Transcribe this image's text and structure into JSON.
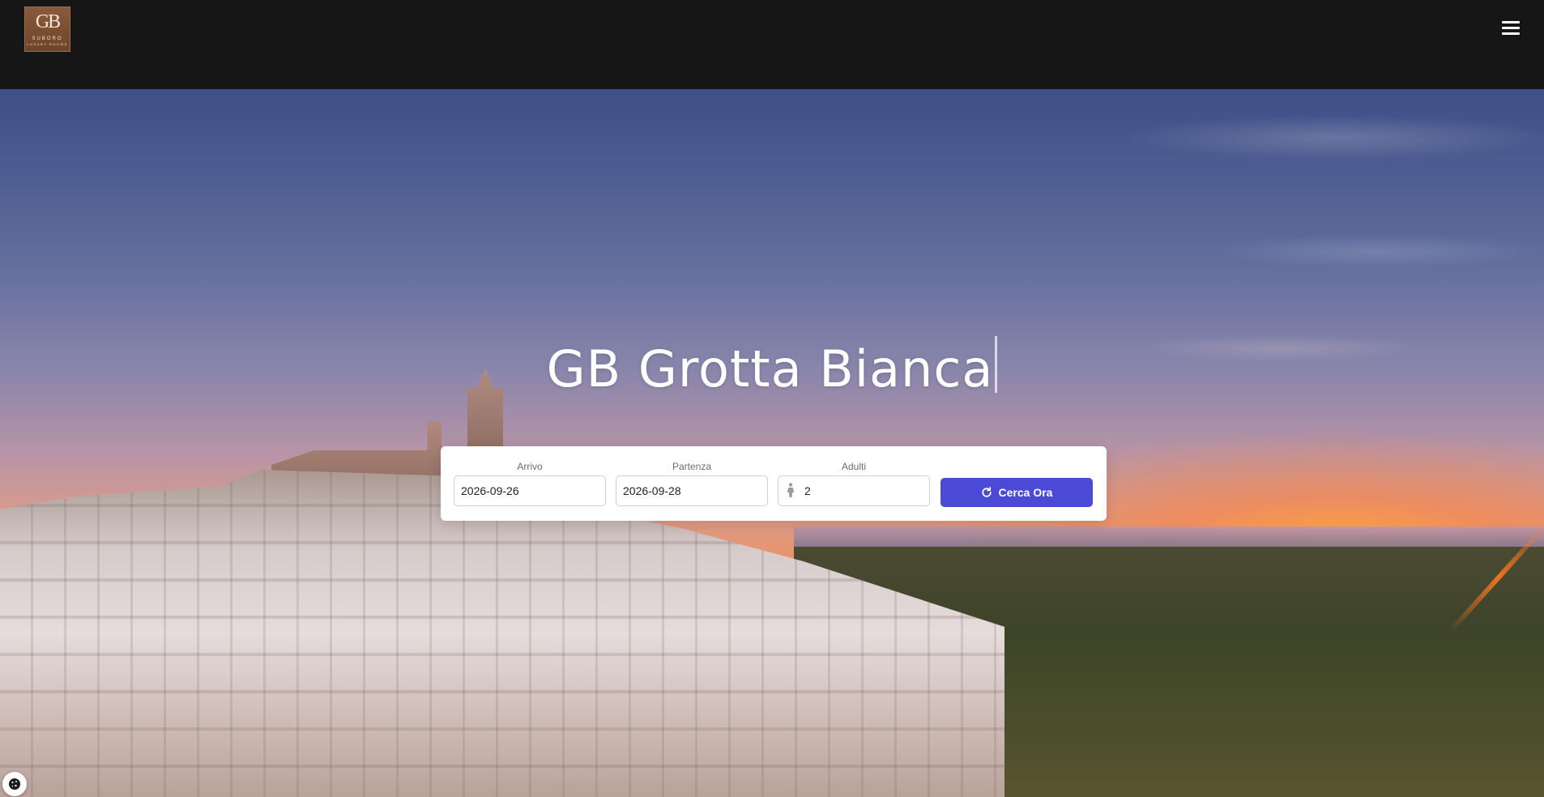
{
  "header": {
    "logo": {
      "monogram": "GB",
      "line1": "SUBORO",
      "line2": "LUXURY ROOMS"
    },
    "menu_icon": "hamburger-menu-icon"
  },
  "hero": {
    "title": "GB Grotta Bianca"
  },
  "booking": {
    "arrival_label": "Arrivo",
    "arrival_value": "2026-09-26",
    "departure_label": "Partenza",
    "departure_value": "2026-09-28",
    "adults_label": "Adulti",
    "adults_value": "2",
    "adults_icon": "person-icon",
    "search_label": "Cerca Ora",
    "search_icon": "refresh-icon"
  },
  "cookie": {
    "icon": "cookie-icon"
  },
  "colors": {
    "header_bg": "#161616",
    "accent": "#4b4ad6",
    "logo_bg": "#7a4d31"
  }
}
